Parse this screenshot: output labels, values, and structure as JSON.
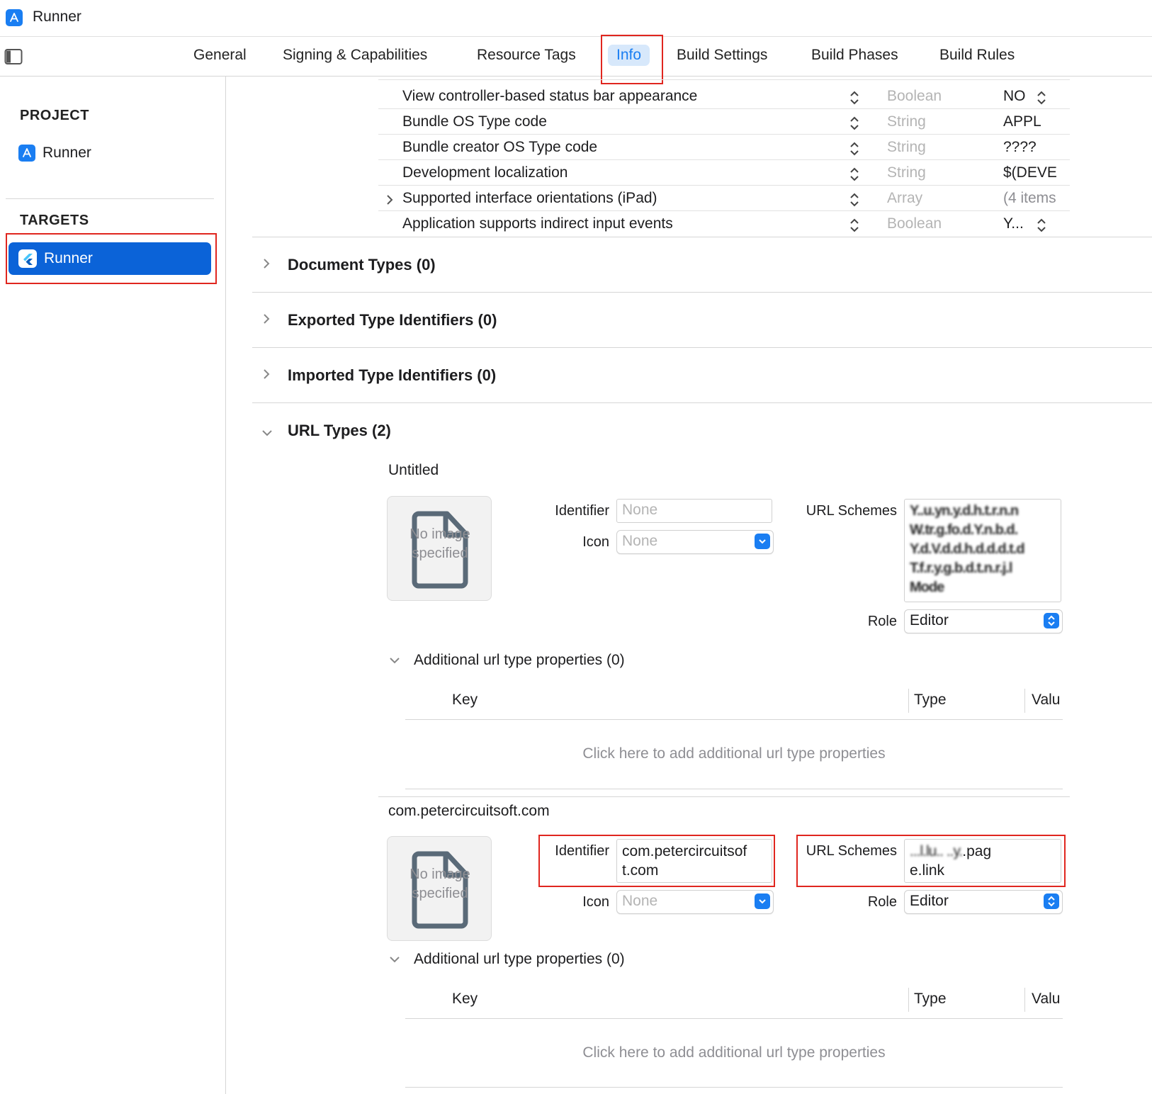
{
  "window": {
    "title": "Runner",
    "app_icon": "xcode-app-icon",
    "sidebar_toggle_icon": "sidebar-toggle-icon"
  },
  "tabs": [
    {
      "label": "General"
    },
    {
      "label": "Signing & Capabilities"
    },
    {
      "label": "Resource Tags"
    },
    {
      "label": "Info",
      "active": true
    },
    {
      "label": "Build Settings"
    },
    {
      "label": "Build Phases"
    },
    {
      "label": "Build Rules"
    }
  ],
  "sidebar": {
    "project_heading": "PROJECT",
    "project_item": "Runner",
    "targets_heading": "TARGETS",
    "target_item": "Runner"
  },
  "plist_rows": [
    {
      "key": "View controller-based status bar appearance",
      "type": "Boolean",
      "value": "NO"
    },
    {
      "key": "Bundle OS Type code",
      "type": "String",
      "value": "APPL"
    },
    {
      "key": "Bundle creator OS Type code",
      "type": "String",
      "value": "????"
    },
    {
      "key": "Development localization",
      "type": "String",
      "value": "$(DEVE"
    },
    {
      "key": "Supported interface orientations (iPad)",
      "type": "Array",
      "value": "(4 items"
    },
    {
      "key": "Application supports indirect input events",
      "type": "Boolean",
      "value": "Y..."
    }
  ],
  "sections": {
    "document_types": "Document Types (0)",
    "exported_types": "Exported Type Identifiers (0)",
    "imported_types": "Imported Type Identifiers (0)",
    "url_types": "URL Types (2)"
  },
  "url_type_1": {
    "name": "Untitled",
    "image_placeholder": "No image specified",
    "identifier_label": "Identifier",
    "identifier_placeholder": "None",
    "icon_label": "Icon",
    "icon_value": "None",
    "url_schemes_label": "URL Schemes",
    "url_schemes_lines": [
      "Y..u.yn.y.d.h.t.r.n.n",
      "W.tr.g.fo.d.Y.n.b.d.",
      "Y.d.V.d.d.h.d.d.d.t.d",
      "T.f.r.y.g.b.d.t.n.r.j.l",
      "Mode"
    ],
    "role_label": "Role",
    "role_value": "Editor",
    "additional_heading": "Additional url type properties (0)",
    "col_key": "Key",
    "col_type": "Type",
    "col_value": "Valu",
    "add_hint": "Click here to add additional url type properties"
  },
  "url_type_2": {
    "name": "com.petercircuitsoft.com",
    "image_placeholder": "No image specified",
    "identifier_label": "Identifier",
    "identifier_line1": "com.petercircuitsof",
    "identifier_line2": "t.com",
    "icon_label": "Icon",
    "icon_value": "None",
    "url_schemes_label": "URL Schemes",
    "url_schemes_line1_blur": "...l.lu.. ..y.",
    "url_schemes_line1_end": ".pag",
    "url_schemes_line2": "e.link",
    "role_label": "Role",
    "role_value": "Editor",
    "additional_heading": "Additional url type properties (0)",
    "col_key": "Key",
    "col_type": "Type",
    "col_value": "Valu",
    "add_hint": "Click here to add additional url type properties"
  },
  "colors": {
    "accent": "#1a7ef2",
    "selection": "#0b63d8",
    "highlight_box": "#e0261f",
    "placeholder_text": "#b4b4b4"
  }
}
